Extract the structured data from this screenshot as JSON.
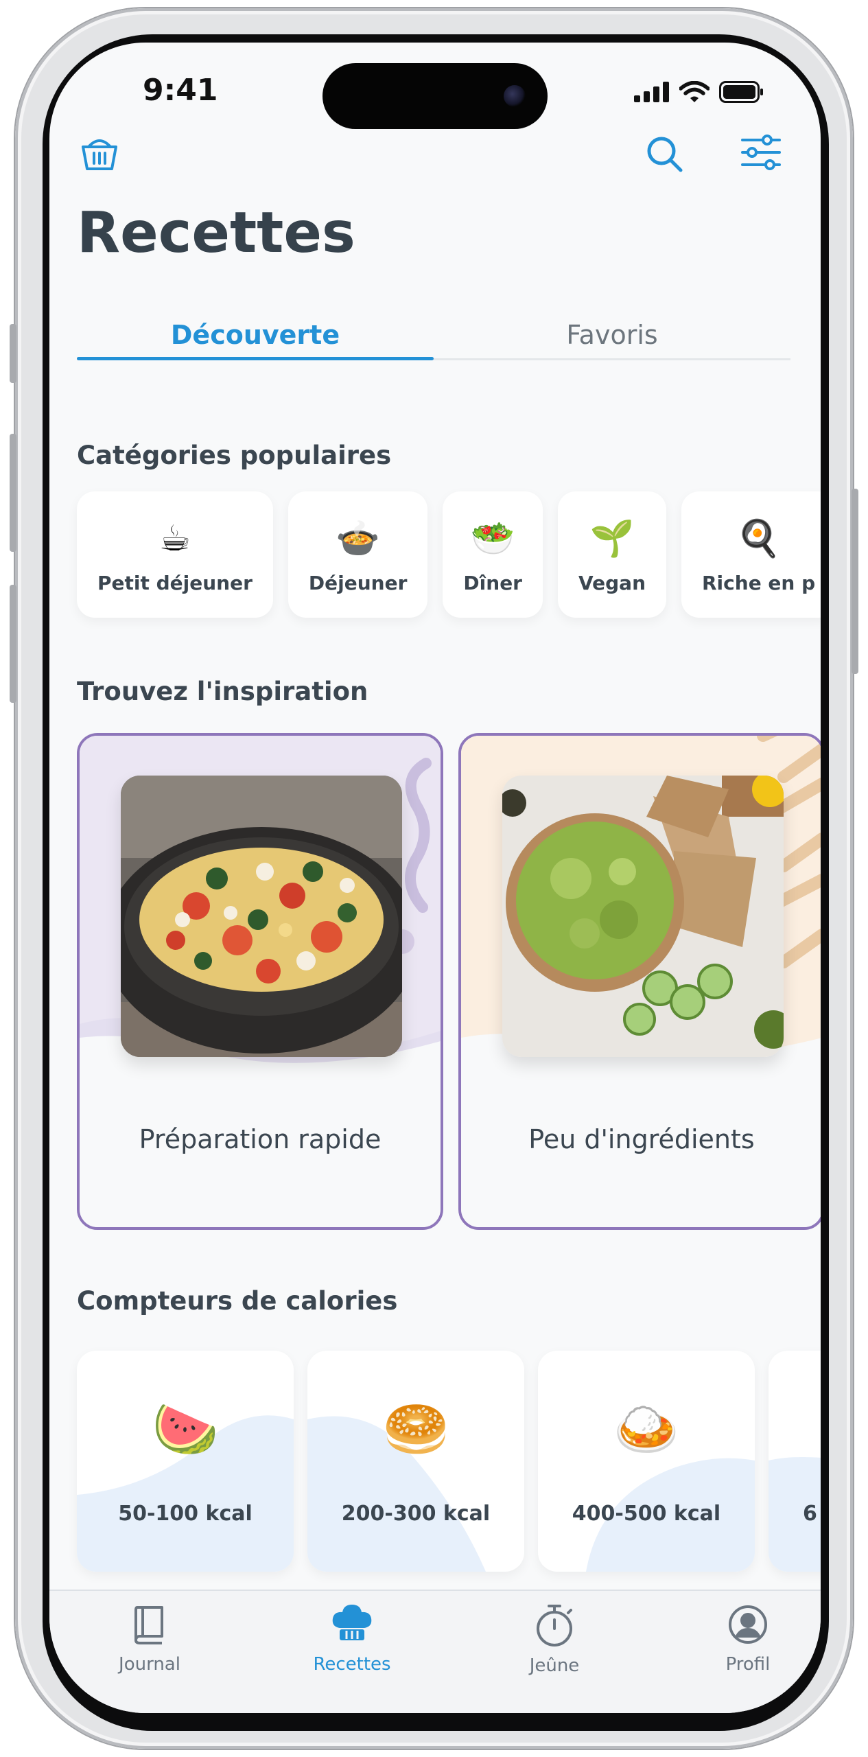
{
  "status_bar": {
    "time": "9:41"
  },
  "header": {
    "basket_icon": "basket-icon",
    "search_icon": "search-icon",
    "filter_icon": "sliders-icon",
    "title": "Recettes"
  },
  "tabs": [
    {
      "label": "Découverte",
      "active": true
    },
    {
      "label": "Favoris",
      "active": false
    }
  ],
  "categories": {
    "title": "Catégories populaires",
    "items": [
      {
        "label": "Petit déjeuner",
        "emoji": "☕"
      },
      {
        "label": "Déjeuner",
        "emoji": "🍲"
      },
      {
        "label": "Dîner",
        "emoji": "🥗"
      },
      {
        "label": "Vegan",
        "emoji": "🌱"
      },
      {
        "label": "Riche en p",
        "emoji": "🍳"
      }
    ]
  },
  "inspiration": {
    "title": "Trouvez l'inspiration",
    "cards": [
      {
        "label": "Préparation rapide",
        "photo": "scrambled-eggs-photo"
      },
      {
        "label": "Peu d'ingrédients",
        "photo": "guacamole-photo"
      }
    ]
  },
  "calories": {
    "title": "Compteurs de calories",
    "items": [
      {
        "label": "50-100 kcal",
        "emoji": "🍉"
      },
      {
        "label": "200-300 kcal",
        "emoji": "🥯"
      },
      {
        "label": "400-500 kcal",
        "emoji": "🍛"
      },
      {
        "label": "6",
        "emoji": ""
      }
    ]
  },
  "bottom_nav": [
    {
      "label": "Journal",
      "icon": "book-icon",
      "active": false
    },
    {
      "label": "Recettes",
      "icon": "chef-hat-icon",
      "active": true
    },
    {
      "label": "Jeûne",
      "icon": "stopwatch-icon",
      "active": false
    },
    {
      "label": "Profil",
      "icon": "profile-icon",
      "active": false
    }
  ],
  "colors": {
    "accent": "#2391d6",
    "text": "#36424c",
    "card_border": "#8e76ba",
    "background": "#f8f9fa"
  }
}
